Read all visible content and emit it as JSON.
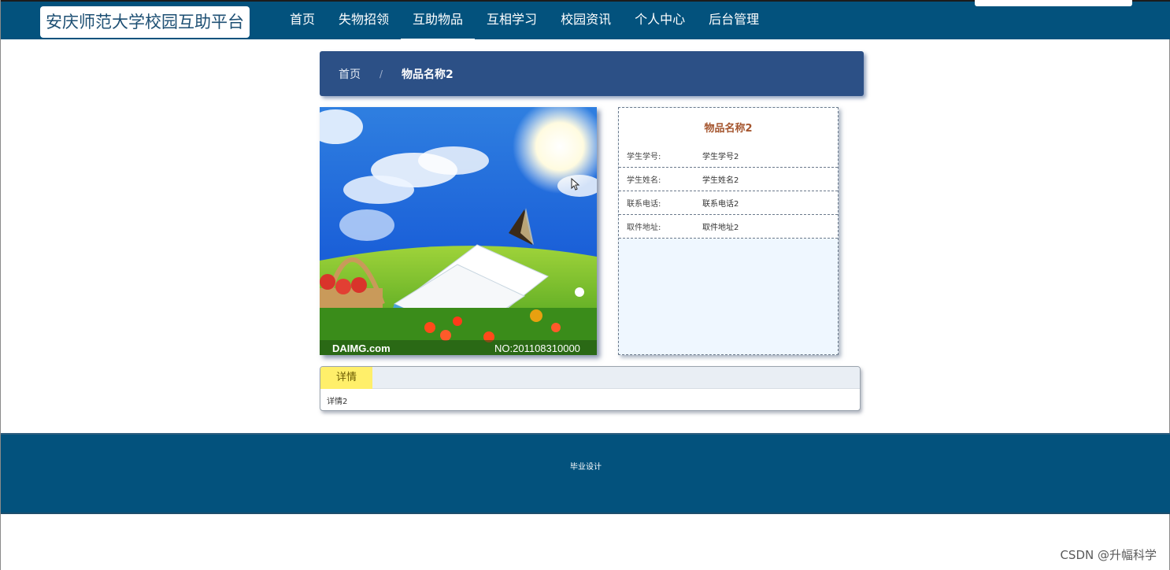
{
  "header": {
    "logo_text": "安庆师范大学校园互助平台",
    "nav": [
      {
        "label": "首页"
      },
      {
        "label": "失物招领"
      },
      {
        "label": "互助物品"
      },
      {
        "label": "互相学习"
      },
      {
        "label": "校园资讯"
      },
      {
        "label": "个人中心"
      },
      {
        "label": "后台管理"
      }
    ],
    "active_nav": "互助物品"
  },
  "breadcrumb": {
    "home": "首页",
    "separator": "/",
    "current": "物品名称2"
  },
  "photo": {
    "watermark_left": "DAIMG.com",
    "watermark_right": "NO:201108310000"
  },
  "item": {
    "title": "物品名称2",
    "fields": [
      {
        "label": "学生学号:",
        "value": "学生学号2"
      },
      {
        "label": "学生姓名:",
        "value": "学生姓名2"
      },
      {
        "label": "联系电话:",
        "value": "联系电话2"
      },
      {
        "label": "取件地址:",
        "value": "取件地址2"
      }
    ]
  },
  "details": {
    "tab_label": "详情",
    "content": "详情2"
  },
  "footer": {
    "text": "毕业设计"
  },
  "watermark": "CSDN @升幅科学",
  "colors": {
    "nav_bg": "#03527d",
    "breadcrumb_bg": "#2c5086",
    "title_color": "#a5562f",
    "tab_bg": "#ffef6a",
    "panel_bg": "#eff7ff"
  }
}
